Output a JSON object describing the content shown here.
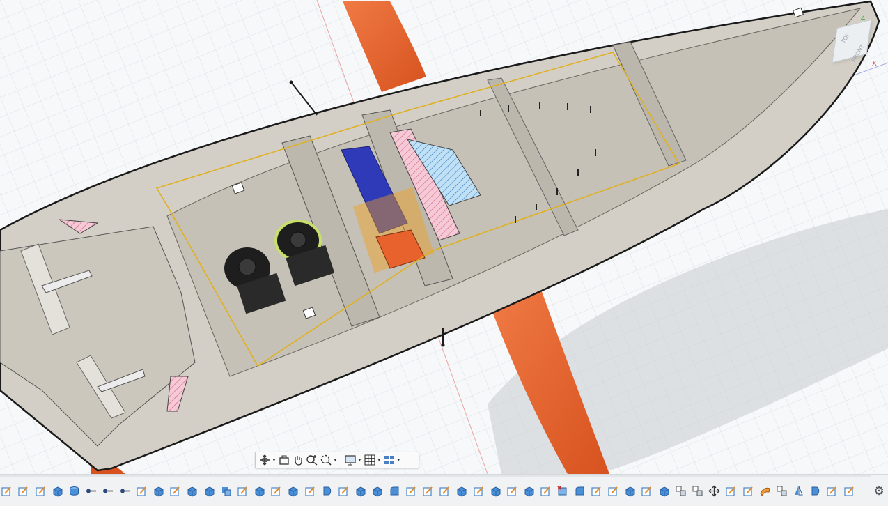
{
  "viewcube": {
    "top_label": "TOP",
    "front_label": "FRONT",
    "axis_x": "X",
    "axis_z": "Z"
  },
  "navbar": {
    "items": [
      {
        "icon": "orbit-icon",
        "dropdown": true
      },
      {
        "icon": "look-at-icon",
        "dropdown": false
      },
      {
        "icon": "pan-icon",
        "dropdown": false
      },
      {
        "icon": "zoom-icon",
        "dropdown": false
      },
      {
        "icon": "fit-icon",
        "dropdown": true
      },
      {
        "icon": "display-settings-icon",
        "dropdown": true
      },
      {
        "icon": "grid-settings-icon",
        "dropdown": true
      },
      {
        "icon": "viewports-icon",
        "dropdown": true
      }
    ]
  },
  "timeline": {
    "features": [
      "sketch",
      "sketch",
      "sketch",
      "extrude",
      "body",
      "joint",
      "joint",
      "joint",
      "sketch",
      "extrude",
      "sketch",
      "extrude",
      "extrude",
      "combine",
      "sketch",
      "extrude",
      "sketch",
      "extrude",
      "sketch",
      "revolve",
      "sketch",
      "extrude",
      "extrude",
      "fillet",
      "sketch",
      "sketch",
      "sketch",
      "extrude",
      "sketch",
      "extrude",
      "sketch",
      "extrude",
      "sketch",
      "split",
      "fillet",
      "sketch",
      "sketch",
      "extrude",
      "sketch",
      "extrude",
      "component",
      "component",
      "move",
      "sketch",
      "sketch",
      "surface",
      "component",
      "mirror",
      "revolve",
      "sketch",
      "sketch"
    ],
    "settings_icon": "gear-icon"
  },
  "colors": {
    "hull": "#d3cfc6",
    "fin": "#e8622e",
    "servo_blue": "#2f3ab8",
    "accent_orange": "#f0a020",
    "grid": "#dfe3e8"
  }
}
